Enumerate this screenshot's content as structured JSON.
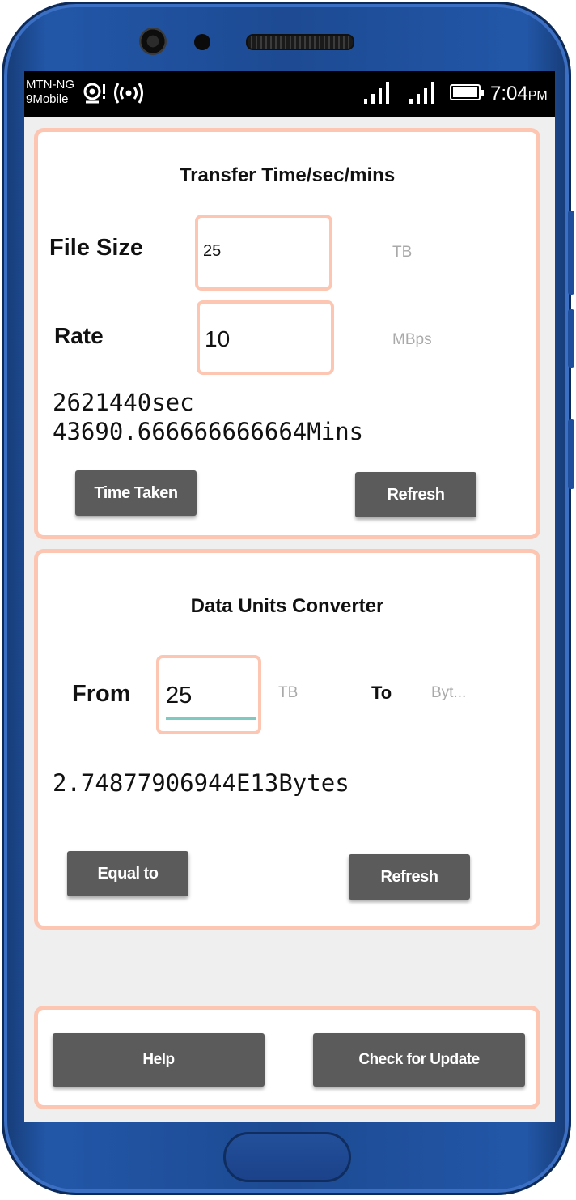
{
  "status_bar": {
    "carrier_1": "MTN-NG",
    "carrier_2": "9Mobile",
    "time": "7:04",
    "ampm": "PM",
    "icons": [
      "alert-icon",
      "hotspot-icon",
      "signal-icon",
      "signal-icon",
      "battery-icon"
    ]
  },
  "transfer": {
    "title": "Transfer Time/sec/mins",
    "file_size_label": "File Size",
    "file_size_value": "25",
    "file_size_unit": "TB",
    "rate_label": "Rate",
    "rate_value": "10",
    "rate_unit": "MBps",
    "result_sec": "2621440sec",
    "result_mins": "43690.666666666664Mins",
    "time_taken_button": "Time Taken",
    "refresh_button": "Refresh"
  },
  "converter": {
    "title": "Data Units Converter",
    "from_label": "From",
    "from_value": "25",
    "from_unit": "TB",
    "to_label": "To",
    "to_unit": "Byt...",
    "result": "2.74877906944E13Bytes",
    "equal_button": "Equal to",
    "refresh_button": "Refresh"
  },
  "footer": {
    "help_button": "Help",
    "update_button": "Check for Update"
  },
  "colors": {
    "card_border": "#fcc6b2",
    "button_bg": "#5b5b5b",
    "input_underline": "#7fc9c0",
    "phone_body": "#1d4a92"
  }
}
